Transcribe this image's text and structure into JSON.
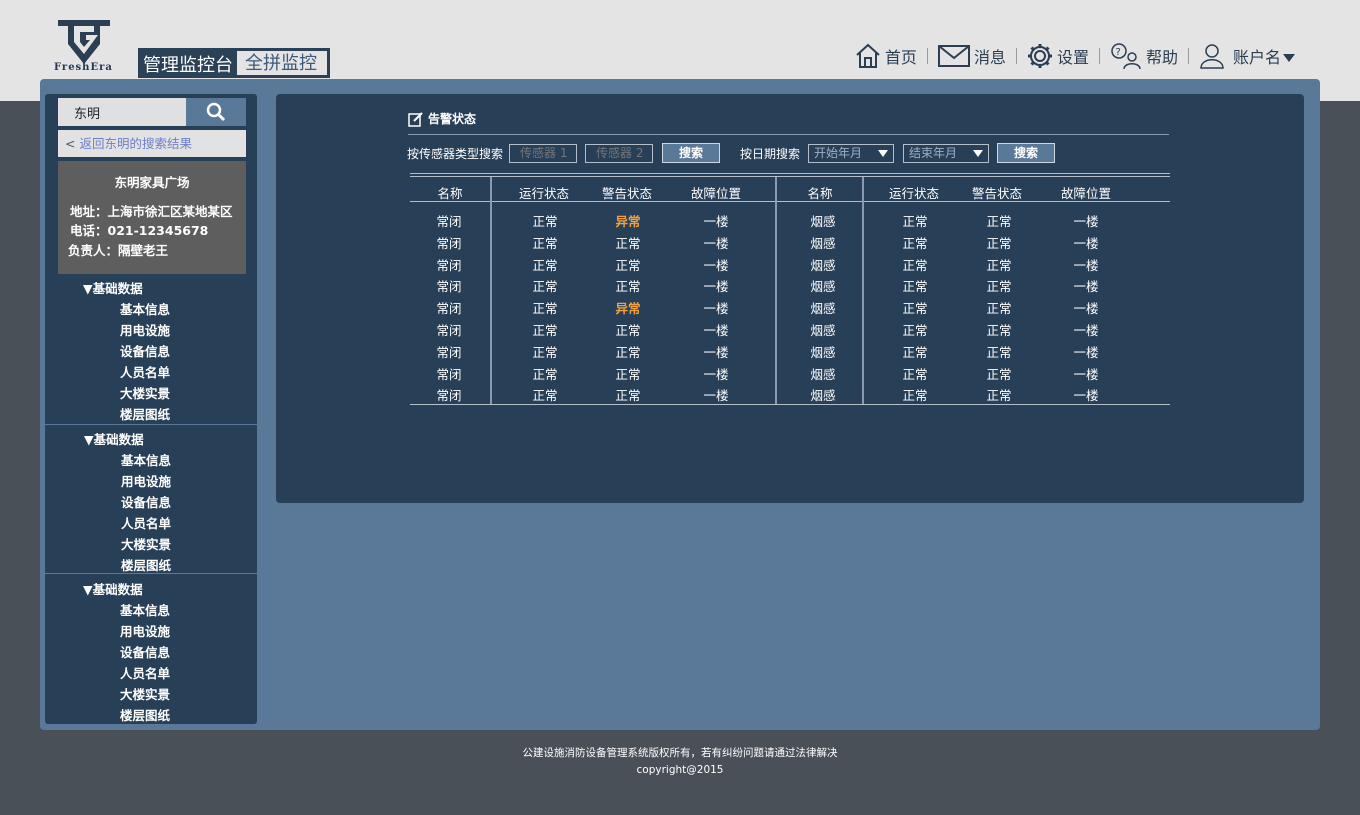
{
  "brand": {
    "logo_text": "FreshEra"
  },
  "title_tabs": {
    "active": "管理监控台",
    "inactive": "全拼监控"
  },
  "topnav": [
    {
      "label": "首页",
      "icon": "home-icon"
    },
    {
      "label": "消息",
      "icon": "mail-icon"
    },
    {
      "label": "设置",
      "icon": "gear-icon"
    },
    {
      "label": "帮助",
      "icon": "help-icon"
    },
    {
      "label": "账户名",
      "icon": "user-icon"
    }
  ],
  "sidebar": {
    "search": {
      "value": "东明"
    },
    "back_link": "返回东明的搜索结果",
    "info": {
      "name": "东明家具广场",
      "address": "地址：上海市徐汇区某地某区",
      "phone": "电话：021-12345678",
      "person": "负责人：隔壁老王"
    },
    "groups": [
      {
        "title": "▼基础数据",
        "items": [
          "基本信息",
          "用电设施",
          "设备信息",
          "人员名单",
          "大楼实景",
          "楼层图纸"
        ]
      },
      {
        "title": "▼基础数据",
        "items": [
          "基本信息",
          "用电设施",
          "设备信息",
          "人员名单",
          "大楼实景",
          "楼层图纸"
        ]
      },
      {
        "title": "▼基础数据",
        "items": [
          "基本信息",
          "用电设施",
          "设备信息",
          "人员名单",
          "大楼实景",
          "楼层图纸"
        ]
      }
    ]
  },
  "panel": {
    "title": "告警状态",
    "filter": {
      "sensor_label": "按传感器类型搜索",
      "sensor1_placeholder": "传感器 1",
      "sensor2_placeholder": "传感器 2",
      "search_label": "搜索",
      "date_label": "按日期搜索",
      "start_placeholder": "开始年月",
      "end_placeholder": "结束年月"
    },
    "headers": [
      "名称",
      "运行状态",
      "警告状态",
      "故障位置",
      "名称",
      "运行状态",
      "警告状态",
      "故障位置"
    ],
    "rows": [
      [
        "常闭",
        "正常",
        "异常",
        "一楼",
        "烟感",
        "正常",
        "正常",
        "一楼"
      ],
      [
        "常闭",
        "正常",
        "正常",
        "一楼",
        "烟感",
        "正常",
        "正常",
        "一楼"
      ],
      [
        "常闭",
        "正常",
        "正常",
        "一楼",
        "烟感",
        "正常",
        "正常",
        "一楼"
      ],
      [
        "常闭",
        "正常",
        "正常",
        "一楼",
        "烟感",
        "正常",
        "正常",
        "一楼"
      ],
      [
        "常闭",
        "正常",
        "异常",
        "一楼",
        "烟感",
        "正常",
        "正常",
        "一楼"
      ],
      [
        "常闭",
        "正常",
        "正常",
        "一楼",
        "烟感",
        "正常",
        "正常",
        "一楼"
      ],
      [
        "常闭",
        "正常",
        "正常",
        "一楼",
        "烟感",
        "正常",
        "正常",
        "一楼"
      ],
      [
        "常闭",
        "正常",
        "正常",
        "一楼",
        "烟感",
        "正常",
        "正常",
        "一楼"
      ],
      [
        "常闭",
        "正常",
        "正常",
        "一楼",
        "烟感",
        "正常",
        "正常",
        "一楼"
      ]
    ]
  },
  "footer": {
    "line1": "公建设施消防设备管理系统版权所有，若有纠纷问题请通过法律解决",
    "line2": "copyright@2015"
  },
  "colors": {
    "header_bg": "#e4e4e4",
    "frame": "#5a7898",
    "panel": "#283f58",
    "warn": "#f0a040",
    "page_bg": "#4a5058"
  }
}
